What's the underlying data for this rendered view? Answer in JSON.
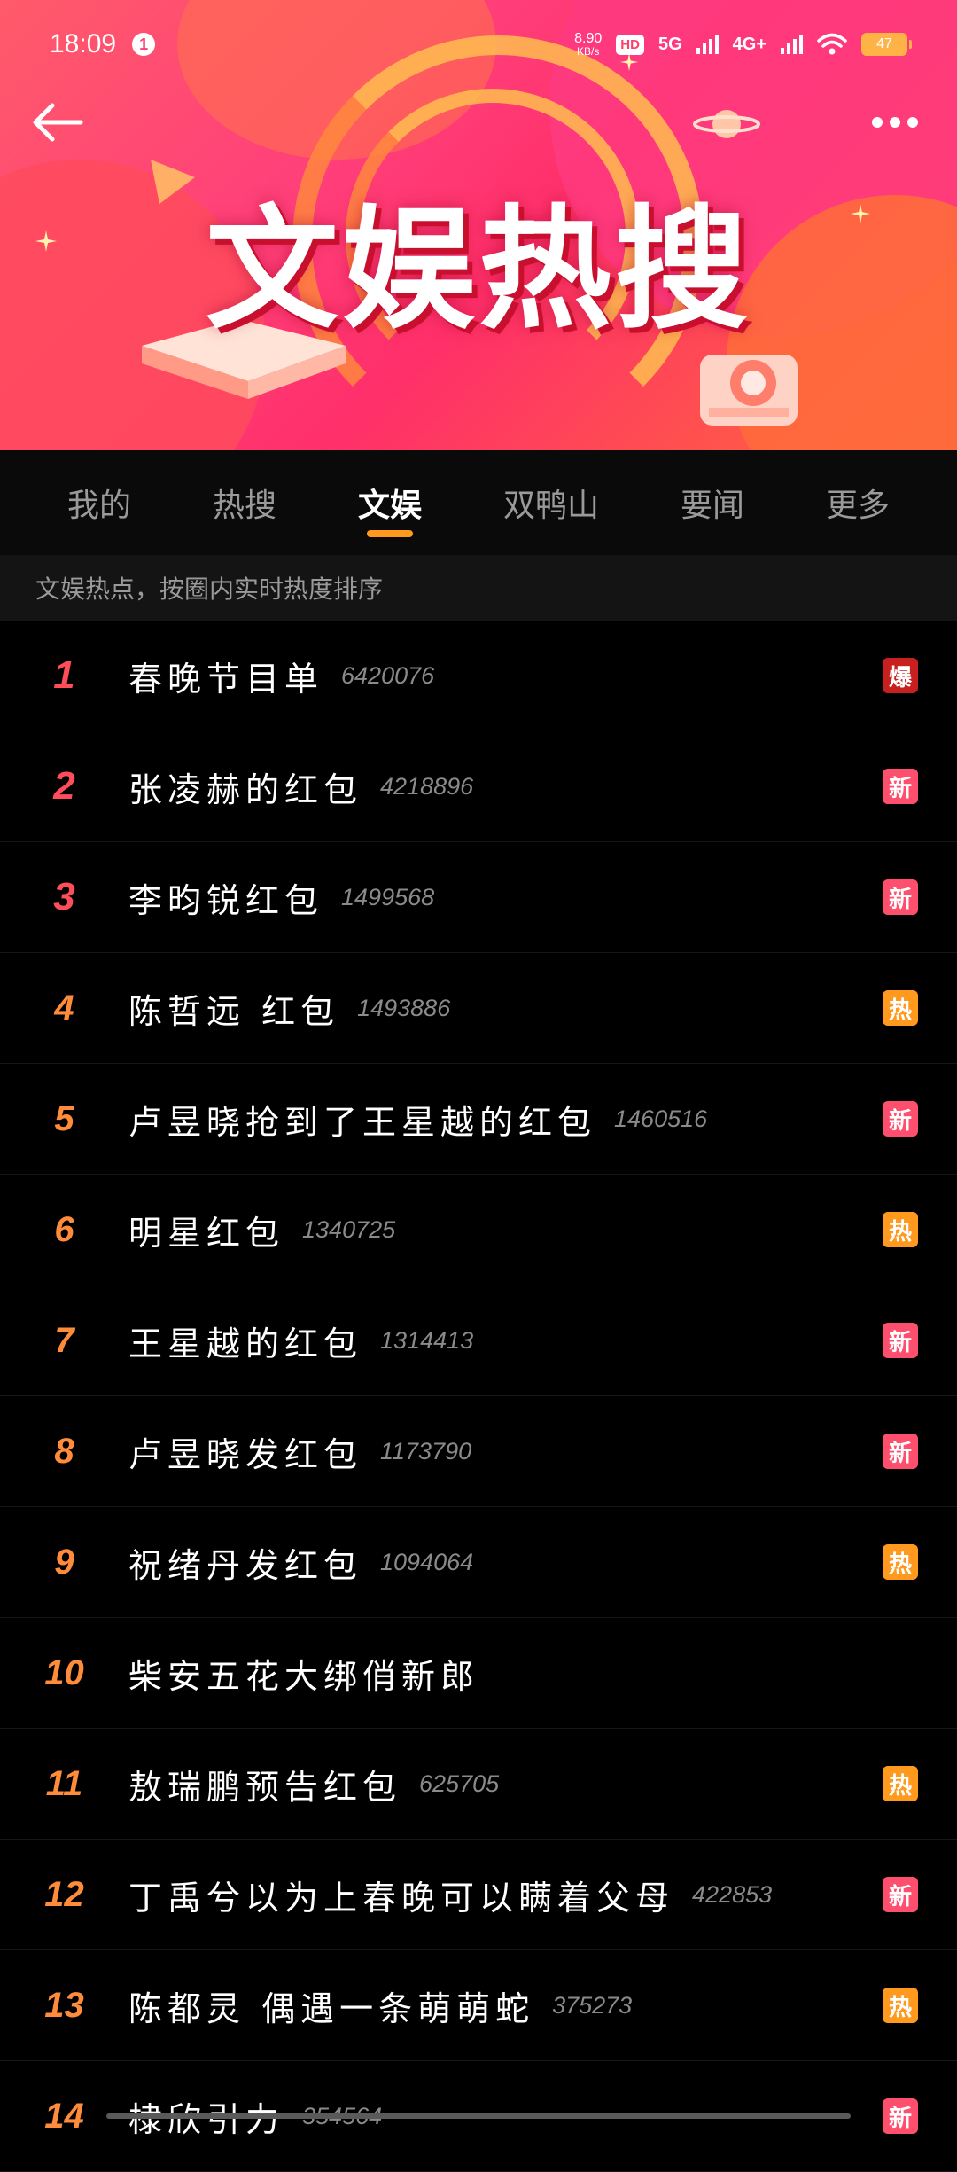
{
  "status_bar": {
    "time": "18:09",
    "notification_count": "1",
    "net_speed": "8.90",
    "net_speed_unit": "KB/s",
    "hd_label": "HD",
    "signal_1": "5G",
    "signal_2": "4G+",
    "battery": "47"
  },
  "header": {
    "banner_title": "文娱热搜"
  },
  "tabs": [
    {
      "label": "我的"
    },
    {
      "label": "热搜"
    },
    {
      "label": "文娱"
    },
    {
      "label": "双鸭山"
    },
    {
      "label": "要闻"
    },
    {
      "label": "更多"
    }
  ],
  "active_tab": "文娱",
  "subheader": "文娱热点，按圈内实时热度排序",
  "list": [
    {
      "rank": "1",
      "title": "春晚节目单",
      "count": "6420076",
      "badge": "爆",
      "badge_type": "bao"
    },
    {
      "rank": "2",
      "title": "张凌赫的红包",
      "count": "4218896",
      "badge": "新",
      "badge_type": "xin"
    },
    {
      "rank": "3",
      "title": "李昀锐红包",
      "count": "1499568",
      "badge": "新",
      "badge_type": "xin"
    },
    {
      "rank": "4",
      "title": "陈哲远 红包",
      "count": "1493886",
      "badge": "热",
      "badge_type": "re"
    },
    {
      "rank": "5",
      "title": "卢昱晓抢到了王星越的红包",
      "count": "1460516",
      "badge": "新",
      "badge_type": "xin"
    },
    {
      "rank": "6",
      "title": "明星红包",
      "count": "1340725",
      "badge": "热",
      "badge_type": "re"
    },
    {
      "rank": "7",
      "title": "王星越的红包",
      "count": "1314413",
      "badge": "新",
      "badge_type": "xin"
    },
    {
      "rank": "8",
      "title": "卢昱晓发红包",
      "count": "1173790",
      "badge": "新",
      "badge_type": "xin"
    },
    {
      "rank": "9",
      "title": "祝绪丹发红包",
      "count": "1094064",
      "badge": "热",
      "badge_type": "re"
    },
    {
      "rank": "10",
      "title": "柴安五花大绑俏新郎",
      "count": "",
      "badge": "",
      "badge_type": ""
    },
    {
      "rank": "11",
      "title": "敖瑞鹏预告红包",
      "count": "625705",
      "badge": "热",
      "badge_type": "re"
    },
    {
      "rank": "12",
      "title": "丁禹兮以为上春晚可以瞒着父母",
      "count": "422853",
      "badge": "新",
      "badge_type": "xin"
    },
    {
      "rank": "13",
      "title": "陈都灵 偶遇一条萌萌蛇",
      "count": "375273",
      "badge": "热",
      "badge_type": "re"
    },
    {
      "rank": "14",
      "title": "棣欣引力",
      "count": "354564",
      "badge": "新",
      "badge_type": "xin"
    }
  ]
}
